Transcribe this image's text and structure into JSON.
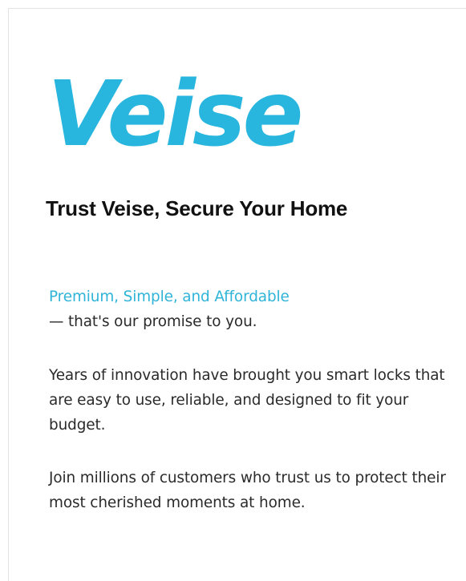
{
  "brand": {
    "logo_text": "Veise",
    "accent_color": "#29b6de"
  },
  "headline": {
    "text": "Trust Veise, Secure Your Home"
  },
  "promise": {
    "highlight": "Premium, Simple, and Affordable",
    "tail": "— that's our promise to you."
  },
  "paragraphs": {
    "innovation": "Years of innovation have brought you smart locks that are easy to use, reliable, and designed to fit your budget.",
    "join": "Join millions of customers who trust us to protect their most cherished moments at home."
  }
}
